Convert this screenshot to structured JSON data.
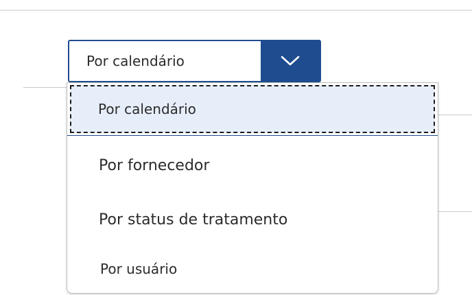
{
  "select": {
    "selected_value": "Por calendário",
    "chevron_icon": "chevron-down-icon",
    "accent_color": "#1e4c8f"
  },
  "dropdown": {
    "options": [
      {
        "label": "Por calendário",
        "highlighted": true
      },
      {
        "label": "Por fornecedor",
        "highlighted": false
      },
      {
        "label": "Por status de tratamento",
        "highlighted": false
      },
      {
        "label": "Por usuário",
        "highlighted": false
      }
    ]
  }
}
